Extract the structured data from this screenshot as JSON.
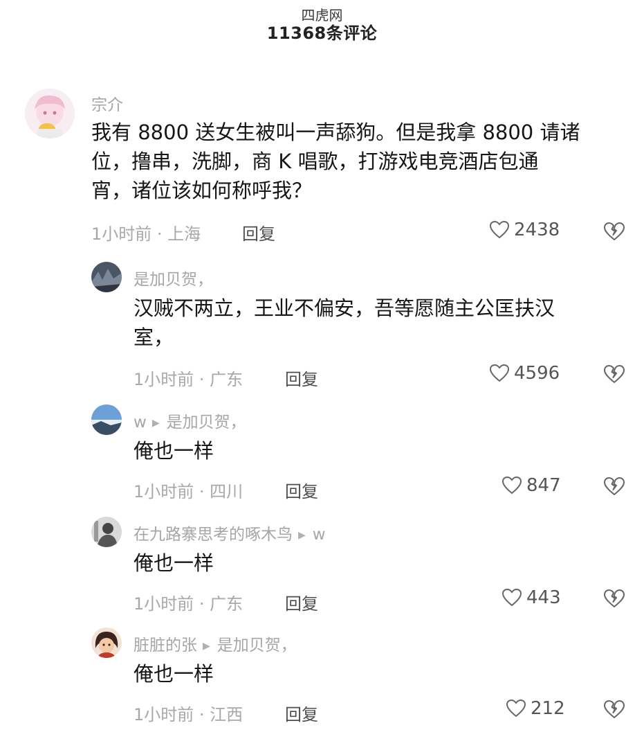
{
  "watermark": "四虎网",
  "header": {
    "title": "11368条评论"
  },
  "comments": [
    {
      "username": "宗介",
      "content": "我有8800送女生被叫一声舔狗。但是我拿8800请诸位，撸串，洗脚，商K唱歌，打游戏电竞酒店包通宵，诸位该如何称呼我？",
      "line1": "我有 8800 送女生被叫一声舔狗。但是我拿 8800 请诸",
      "line2": "位，撸串，洗脚，商 K 唱歌，打游戏电竞酒店包通",
      "line3": "宵，诸位该如何称呼我？",
      "meta": "1小时前 · 上海",
      "reply_label": "回复",
      "likes": "2438"
    }
  ],
  "replies": [
    {
      "username": "是加贝贺，",
      "target": "",
      "line1": "汉贼不两立，王业不偏安，吾等愿随主公匡扶汉",
      "line2": "室，",
      "meta": "1小时前 · 广东",
      "reply_label": "回复",
      "likes": "4596"
    },
    {
      "username": "w",
      "target": "是加贝贺，",
      "line1": "俺也一样",
      "meta": "1小时前 · 四川",
      "reply_label": "回复",
      "likes": "847"
    },
    {
      "username": "在九路寨思考的啄木鸟",
      "target": "w",
      "line1": "俺也一样",
      "meta": "1小时前 · 广东",
      "reply_label": "回复",
      "likes": "443"
    },
    {
      "username": "脏脏的张",
      "target": "是加贝贺，",
      "line1": "俺也一样",
      "meta": "1小时前 · 江西",
      "reply_label": "回复",
      "likes": "212"
    }
  ],
  "icons": {
    "like": "heart-outline-icon",
    "dislike": "broken-heart-icon",
    "reply_arrow": "play-triangle-icon"
  },
  "colors": {
    "text": "#161616",
    "muted": "#a6a6a6",
    "background": "#ffffff"
  }
}
